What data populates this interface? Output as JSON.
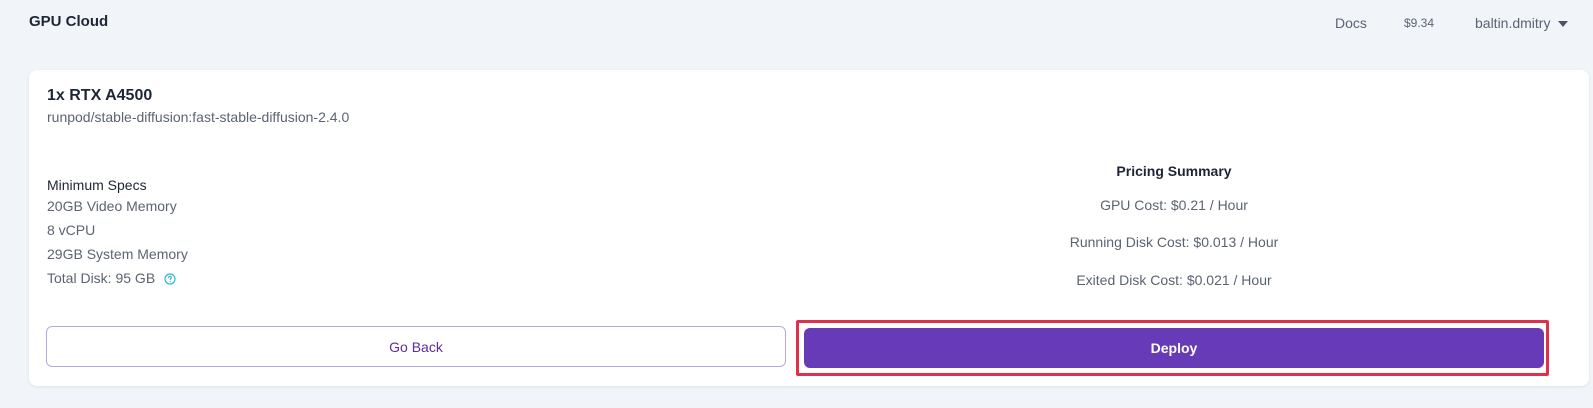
{
  "app": {
    "brand": "GPU Cloud"
  },
  "topnav": {
    "docs_label": "Docs",
    "balance": "$9.34",
    "username": "baltin.dmitry"
  },
  "pod": {
    "gpu_title": "1x RTX A4500",
    "image": "runpod/stable-diffusion:fast-stable-diffusion-2.4.0"
  },
  "specs": {
    "heading": "Minimum Specs",
    "video_memory": "20GB Video Memory",
    "vcpu": "8 vCPU",
    "system_memory": "29GB System Memory",
    "total_disk": "Total Disk: 95 GB"
  },
  "pricing": {
    "heading": "Pricing Summary",
    "gpu_cost": "GPU Cost: $0.21 / Hour",
    "running_disk_cost": "Running Disk Cost: $0.013 / Hour",
    "exited_disk_cost": "Exited Disk Cost: $0.021 / Hour"
  },
  "actions": {
    "back_label": "Go Back",
    "deploy_label": "Deploy"
  },
  "icons": {
    "help": "question-circle-icon",
    "user_menu": "caret-down-icon"
  },
  "colors": {
    "page_background": "#f1f4f9",
    "primary": "#673ab7",
    "secondary_outline": "#b9a7e2",
    "highlight": "#e0314b",
    "help_icon": "#2bb5d9"
  }
}
